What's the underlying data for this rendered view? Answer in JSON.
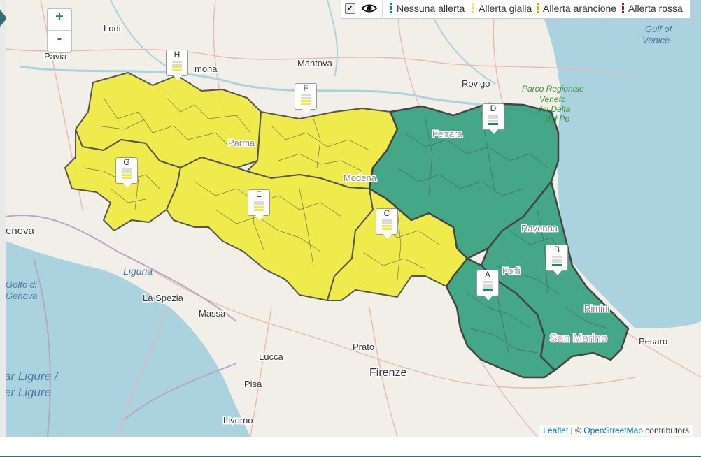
{
  "zoom": {
    "in_label": "+",
    "out_label": "-"
  },
  "legend": {
    "toggle_checked": true,
    "toggle_symbol": "✔",
    "eye_icon": "eye-icon",
    "items": [
      {
        "label": "Nessuna allerta",
        "color": "#1a8a5c"
      },
      {
        "label": "Allerta gialla",
        "color": "#f2e84a"
      },
      {
        "label": "Allerta arancione",
        "color": "#e5a00d"
      },
      {
        "label": "Allerta rossa",
        "color": "#9b1b1b"
      }
    ]
  },
  "places": {
    "lodi": "Lodi",
    "pavia": "Pavia",
    "cremona": "mona",
    "mantova": "Mantova",
    "rovigo": "Rovigo",
    "parma": "Parma",
    "modena": "Modena",
    "ferrara": "Ferrara",
    "ravenna": "Ravenna",
    "forli": "Forlì",
    "rimini": "Rimini",
    "san_marino": "San Marino",
    "pesaro": "Pesaro",
    "genova": "enova",
    "la_spezia": "La Spezia",
    "massa": "Massa",
    "prato": "Prato",
    "lucca": "Lucca",
    "firenze": "Firenze",
    "pisa": "Pisa",
    "livorno": "Livorno",
    "liguria": "Liguria",
    "golfo_genova_1": "Golfo di",
    "golfo_genova_2": "Genova",
    "mar_ligure_1": "ar Ligure /",
    "mar_ligure_2": "er Ligure",
    "gulf_venice_1": "Gulf of",
    "gulf_venice_2": "Venice",
    "parco_1": "Parco Regionale",
    "parco_2": "Veneto",
    "parco_3": "del Delta",
    "parco_4": "del Po"
  },
  "zones": [
    {
      "letter": "H",
      "alert": "Allerta gialla"
    },
    {
      "letter": "F",
      "alert": "Allerta gialla"
    },
    {
      "letter": "G",
      "alert": "Allerta gialla"
    },
    {
      "letter": "E",
      "alert": "Allerta gialla"
    },
    {
      "letter": "C",
      "alert": "Allerta gialla"
    },
    {
      "letter": "D",
      "alert": "Nessuna allerta"
    },
    {
      "letter": "B",
      "alert": "Nessuna allerta"
    },
    {
      "letter": "A",
      "alert": "Nessuna allerta"
    }
  ],
  "attribution": {
    "leaflet": "Leaflet",
    "sep": " | © ",
    "osm": "OpenStreetMap",
    "rest": " contributors"
  }
}
